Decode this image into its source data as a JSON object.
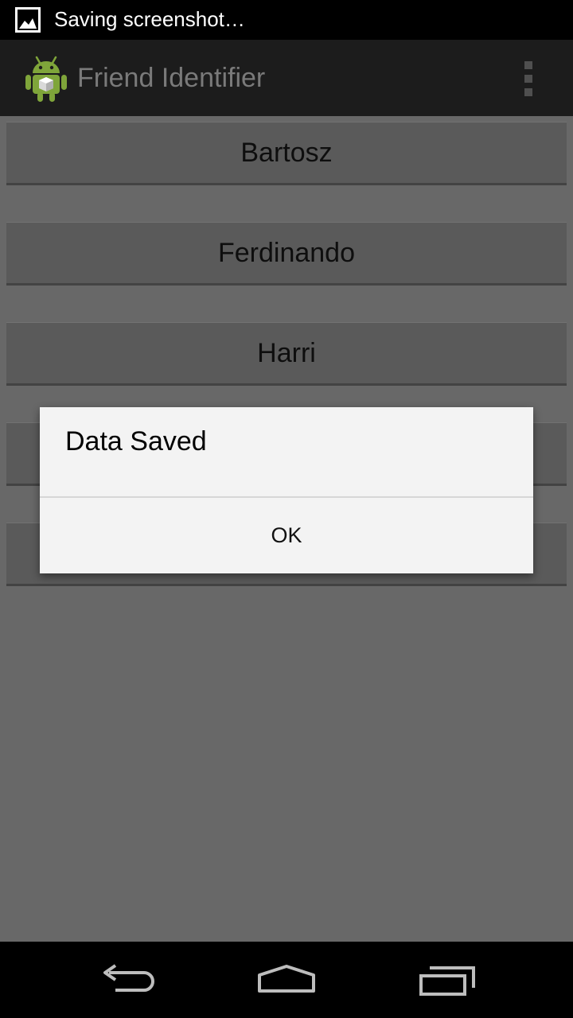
{
  "status_bar": {
    "notification_icon": "image-icon",
    "text": "Saving screenshot…"
  },
  "action_bar": {
    "app_icon": "android-robot-icon",
    "title": "Friend Identifier",
    "overflow_icon": "overflow-menu-icon"
  },
  "friends": [
    {
      "label": "Bartosz"
    },
    {
      "label": "Ferdinando"
    },
    {
      "label": "Harri"
    },
    {
      "label": ""
    },
    {
      "label": ""
    }
  ],
  "dialog": {
    "message": "Data Saved",
    "ok_label": "OK"
  },
  "nav_bar": {
    "back_icon": "back-icon",
    "home_icon": "home-icon",
    "recents_icon": "recent-apps-icon"
  },
  "colors": {
    "content_bg": "#686868",
    "button_bg": "#5a5a5a",
    "action_bar_bg": "#1c1c1c",
    "dialog_bg": "#f3f3f3"
  }
}
